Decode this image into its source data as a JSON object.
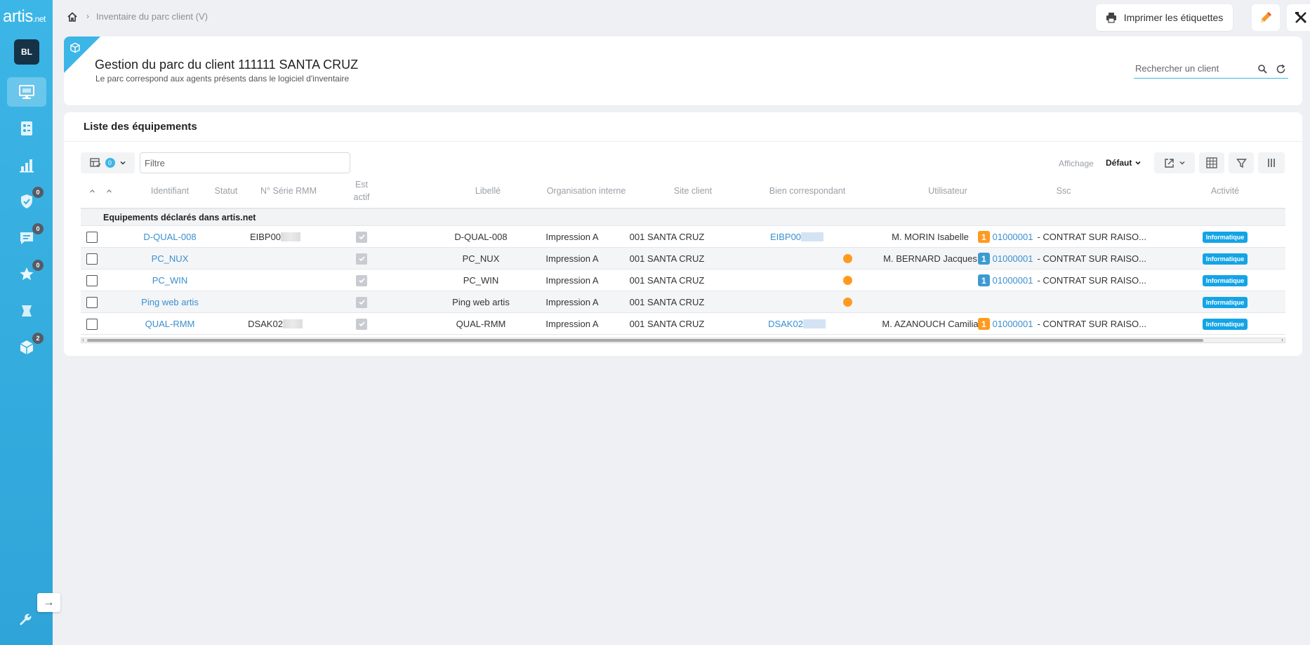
{
  "app": {
    "logo": "artis",
    "logo_suffix": ".net",
    "user_initials": "BL"
  },
  "sidebar": {
    "items": [
      {
        "name": "monitor",
        "badge": ""
      },
      {
        "name": "inventory",
        "badge": ""
      },
      {
        "name": "stats",
        "badge": ""
      },
      {
        "name": "shield",
        "badge": "0"
      },
      {
        "name": "chat",
        "badge": "0"
      },
      {
        "name": "star",
        "badge": "0"
      },
      {
        "name": "script",
        "badge": ""
      },
      {
        "name": "cube",
        "badge": "2"
      }
    ],
    "collapse_glyph": "→"
  },
  "breadcrumb": {
    "separator": "›",
    "current": "Inventaire du parc client (V)"
  },
  "toolbar": {
    "print_label": "Imprimer les étiquettes"
  },
  "header": {
    "title": "Gestion du parc du client 111111 SANTA CRUZ",
    "subtitle": "Le parc correspond aux agents présents dans le logiciel d'inventaire",
    "search_placeholder": "Rechercher un client"
  },
  "list": {
    "title": "Liste des équipements",
    "view_count": "0",
    "filter_placeholder": "Filtre",
    "affichage_label": "Affichage",
    "affichage_value": "Défaut",
    "columns": {
      "identifiant": "Identifiant",
      "statut": "Statut",
      "serie": "N° Série RMM",
      "actif_1": "Est",
      "actif_2": "actif",
      "libelle": "Libellé",
      "organisation": "Organisation interne",
      "site": "Site client",
      "bien": "Bien correspondant",
      "utilisateur": "Utilisateur",
      "ssc": "Ssc",
      "activite": "Activité"
    },
    "group_label": "Equipements déclarés dans artis.net",
    "rows": [
      {
        "id": "D-QUAL-008",
        "serie": "EIBP00",
        "libelle": "D-QUAL-008",
        "organisation": "Impression A",
        "site": "001 SANTA CRUZ",
        "bien": "EIBP00",
        "utilisateur": "M. MORIN Isabelle",
        "ssc_num": "1",
        "ssc_code": "01000001",
        "ssc_text": "- CONTRAT SUR RAISO...",
        "activite": "Informatique"
      },
      {
        "id": "PC_NUX",
        "serie": "",
        "libelle": "PC_NUX",
        "organisation": "Impression A",
        "site": "001 SANTA CRUZ",
        "bien": "",
        "utilisateur": "M. BERNARD Jacques",
        "ssc_num": "1",
        "ssc_code": "01000001",
        "ssc_text": "- CONTRAT SUR RAISO...",
        "activite": "Informatique"
      },
      {
        "id": "PC_WIN",
        "serie": "",
        "libelle": "PC_WIN",
        "organisation": "Impression A",
        "site": "001 SANTA CRUZ",
        "bien": "",
        "utilisateur": "",
        "ssc_num": "1",
        "ssc_code": "01000001",
        "ssc_text": "- CONTRAT SUR RAISO...",
        "activite": "Informatique"
      },
      {
        "id": "Ping web artis",
        "serie": "",
        "libelle": "Ping web artis",
        "organisation": "Impression A",
        "site": "001 SANTA CRUZ",
        "bien": "",
        "utilisateur": "",
        "ssc_num": "",
        "ssc_code": "",
        "ssc_text": "",
        "activite": "Informatique"
      },
      {
        "id": "QUAL-RMM",
        "serie": "DSAK02",
        "libelle": "QUAL-RMM",
        "organisation": "Impression A",
        "site": "001 SANTA CRUZ",
        "bien": "DSAK02",
        "utilisateur": "M. AZANOUCH Camilia",
        "ssc_num": "1",
        "ssc_code": "01000001",
        "ssc_text": "- CONTRAT SUR RAISO...",
        "activite": "Informatique"
      }
    ]
  },
  "colors": {
    "accent": "#3cb6e6",
    "link": "#3a8fd0",
    "orange": "#ff9a1f",
    "blue_badge": "#3d9ad1",
    "tag": "#14a4e6"
  }
}
